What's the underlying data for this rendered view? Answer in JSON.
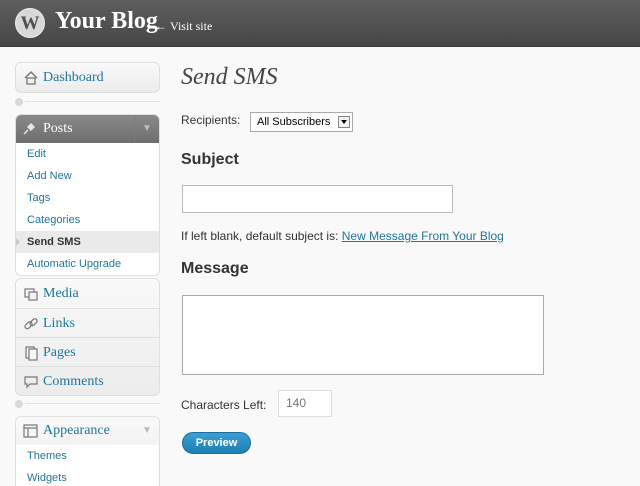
{
  "header": {
    "logo_letter": "W",
    "site_title": "Your Blog",
    "visit_site_arrow": "←",
    "visit_site_label": "Visit site"
  },
  "sidebar": {
    "dashboard": "Dashboard",
    "posts": {
      "label": "Posts",
      "toggle": "▼",
      "items": [
        {
          "label": "Edit"
        },
        {
          "label": "Add New"
        },
        {
          "label": "Tags"
        },
        {
          "label": "Categories"
        },
        {
          "label": "Send SMS"
        },
        {
          "label": "Automatic Upgrade"
        }
      ]
    },
    "media": "Media",
    "links": "Links",
    "pages": "Pages",
    "comments": "Comments",
    "appearance": {
      "label": "Appearance",
      "toggle": "▼",
      "items": [
        {
          "label": "Themes"
        },
        {
          "label": "Widgets"
        }
      ]
    }
  },
  "main": {
    "title": "Send SMS",
    "recipients_label": "Recipients:",
    "recipients_value": "All Subscribers",
    "subject_heading": "Subject",
    "subject_value": "",
    "default_note_prefix": "If left blank, default subject is: ",
    "default_note_link": "New Message From Your Blog",
    "message_heading": "Message",
    "message_value": "",
    "chars_left_label": "Characters Left:",
    "chars_left_value": "140",
    "preview_label": "Preview"
  },
  "colors": {
    "link": "#21759b",
    "header_bg": "#464646",
    "button_blue": "#2583b8"
  }
}
